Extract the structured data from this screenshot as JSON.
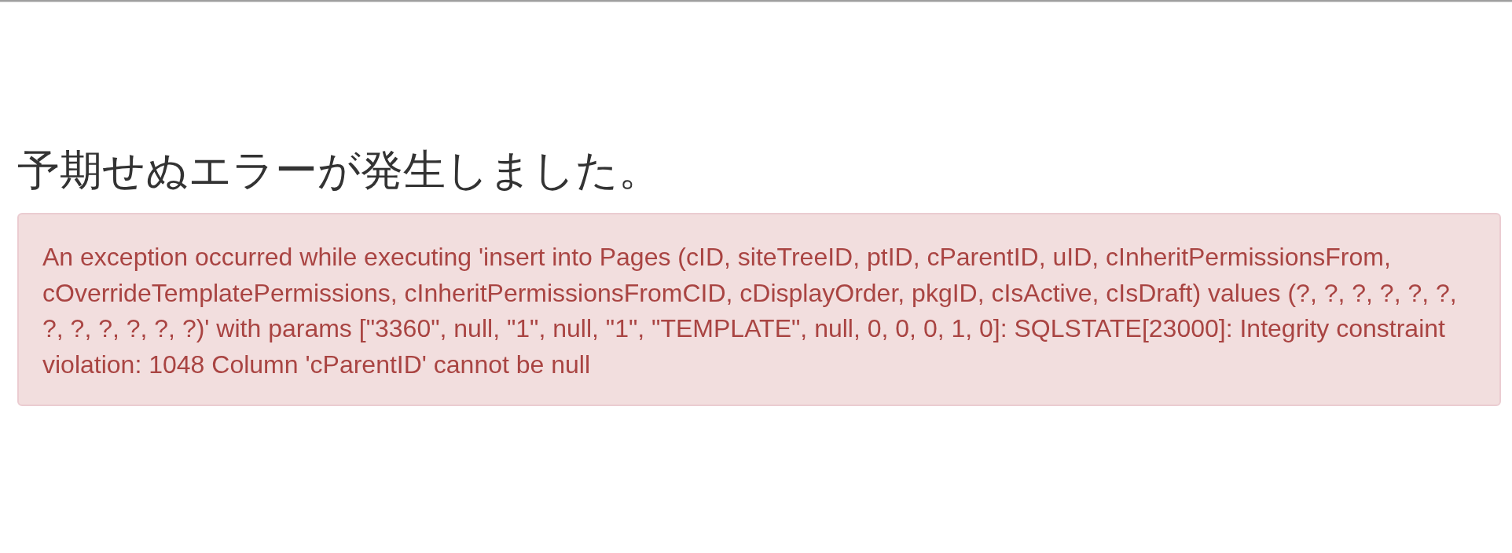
{
  "heading": "予期せぬエラーが発生しました。",
  "alert": {
    "kind": "danger",
    "message": "An exception occurred while executing 'insert into Pages (cID, siteTreeID, ptID, cParentID, uID, cInheritPermissionsFrom, cOverrideTemplatePermissions, cInheritPermissionsFromCID, cDisplayOrder, pkgID, cIsActive, cIsDraft) values (?, ?, ?, ?, ?, ?, ?, ?, ?, ?, ?, ?)' with params [\"3360\", null, \"1\", null, \"1\", \"TEMPLATE\", null, 0, 0, 0, 1, 0]: SQLSTATE[23000]: Integrity constraint violation: 1048 Column 'cParentID' cannot be null"
  }
}
